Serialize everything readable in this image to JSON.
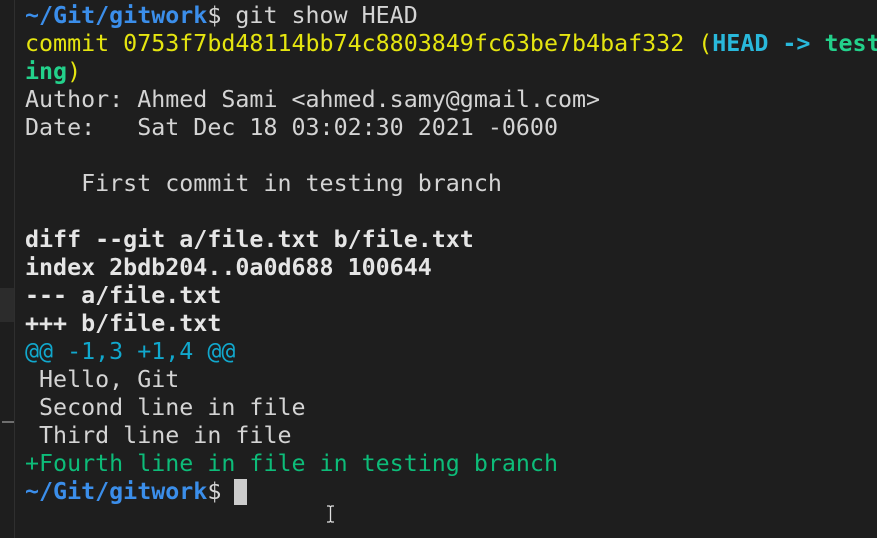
{
  "terminal": {
    "prompt_path": "~/Git/gitwork",
    "prompt_symbol": "$",
    "command": " git show HEAD",
    "commit_label": "commit",
    "commit_hash": " 0753f7bd48114bb74c8803849fc63be7b4baf332",
    "ref_open": " (",
    "ref_head": "HEAD -> ",
    "ref_branch_part1": "test",
    "ref_branch_part2": "ing",
    "ref_close": ")",
    "author_line": "Author: Ahmed Sami <ahmed.samy@gmail.com>",
    "date_line": "Date:   Sat Dec 18 03:02:30 2021 -0600",
    "message_line": "    First commit in testing branch",
    "diff_git_line": "diff --git a/file.txt b/file.txt",
    "index_line": "index 2bdb204..0a0d688 100644",
    "minus_file_line": "--- a/file.txt",
    "plus_file_line": "+++ b/file.txt",
    "hunk_header": "@@ -1,3 +1,4 @@",
    "context_lines": [
      " Hello, Git",
      " Second line in file",
      " Third line in file"
    ],
    "added_line": "+Fourth line in file in testing branch"
  },
  "colors": {
    "background": "#1e1e1e",
    "prompt_blue": "#3b8eea",
    "commit_yellow": "#e5e510",
    "head_cyan": "#29b8db",
    "hunk_cyan": "#11a8cd",
    "added_green": "#0dbc79"
  },
  "icons": {
    "cursor": "block-cursor",
    "pointer": "text-ibeam-cursor"
  }
}
